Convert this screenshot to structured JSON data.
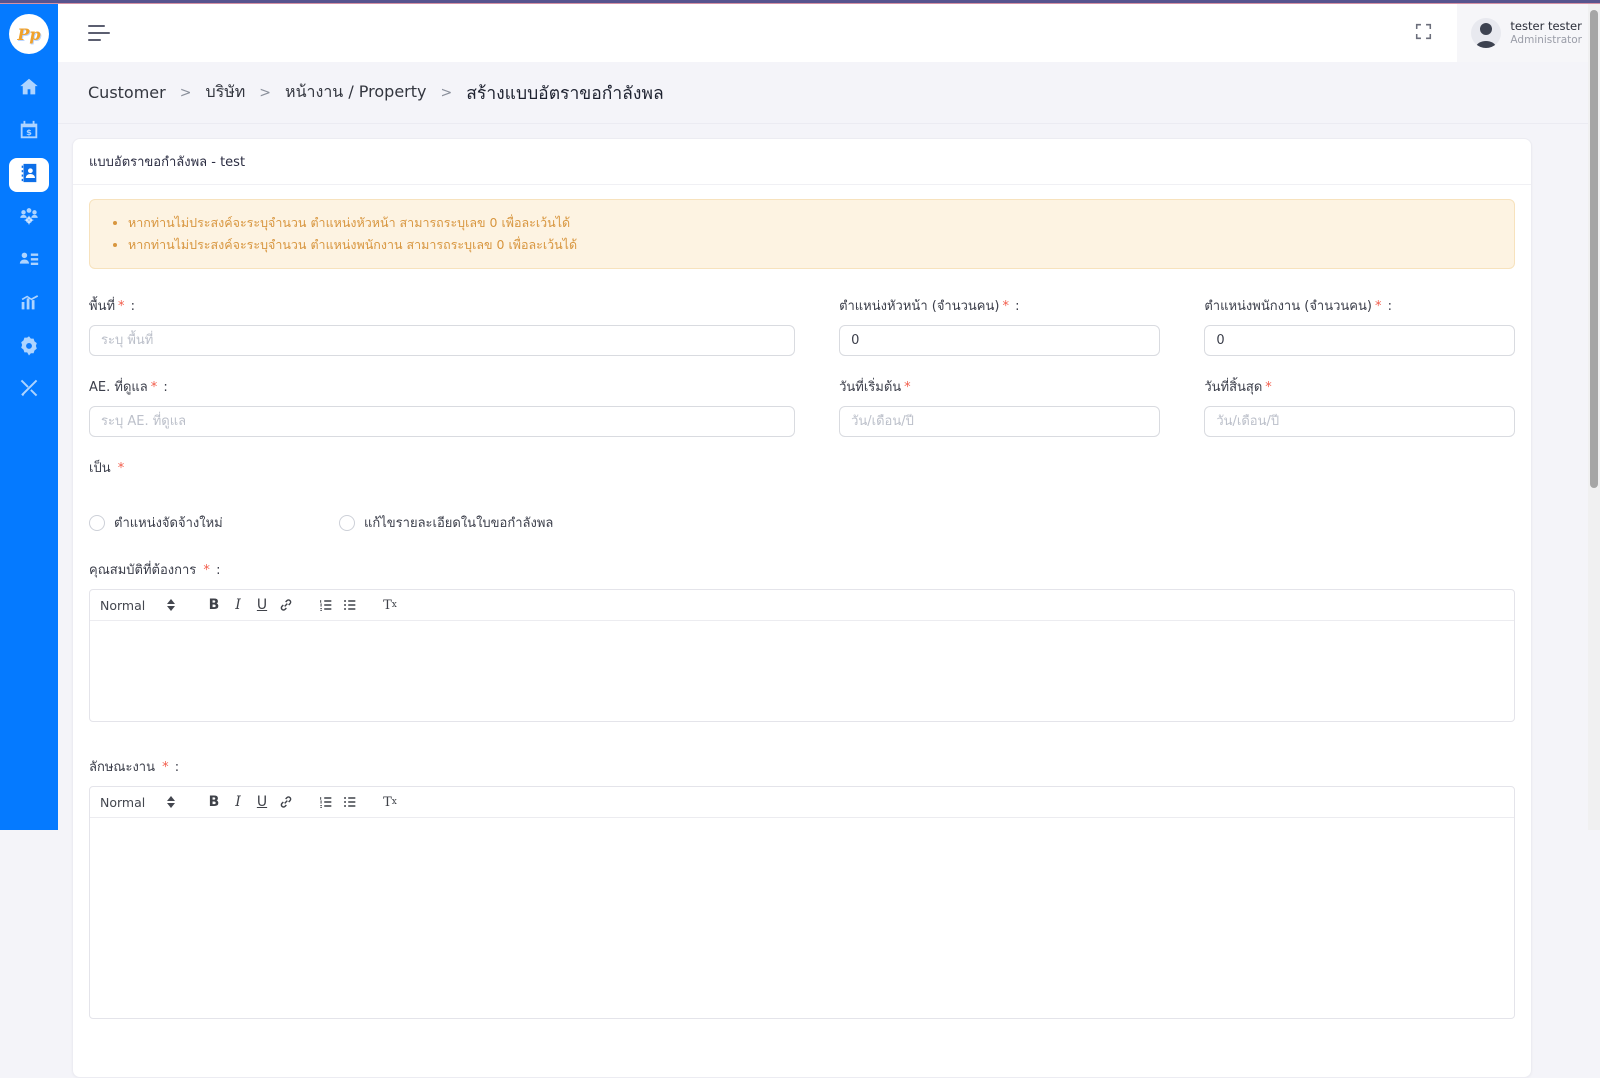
{
  "app": {
    "logo_text": "Pp"
  },
  "sidebar": {
    "color": "#057aff",
    "items": [
      {
        "name": "home",
        "active": false
      },
      {
        "name": "finance-calendar",
        "active": false
      },
      {
        "name": "customer-contacts",
        "active": true
      },
      {
        "name": "team-management",
        "active": false
      },
      {
        "name": "personnel-list",
        "active": false
      },
      {
        "name": "reports-chart",
        "active": false
      },
      {
        "name": "settings",
        "active": false
      },
      {
        "name": "tools",
        "active": false
      }
    ]
  },
  "user": {
    "name": "tester tester",
    "role": "Administrator"
  },
  "breadcrumb": {
    "separator": ">",
    "items": [
      "Customer",
      "บริษัท",
      "หน้างาน / Property",
      "สร้างแบบอัตราขอกำลังพล"
    ]
  },
  "card": {
    "title": "แบบอัตราขอกำลังพล - test"
  },
  "alert": {
    "text_color": "#d8963f",
    "background": "#fdf3e2",
    "items": [
      "หากท่านไม่ประสงค์จะระบุจำนวน ตำแหน่งหัวหน้า สามารถระบุเลข 0 เพื่อละเว้นได้",
      "หากท่านไม่ประสงค์จะระบุจำนวน ตำแหน่งพนักงาน สามารถระบุเลข 0 เพื่อละเว้นได้"
    ]
  },
  "form": {
    "required_mark": "*",
    "colon": ":",
    "area": {
      "label": "พื้นที่",
      "placeholder": "ระบุ พื้นที่",
      "value": ""
    },
    "head_count": {
      "label": "ตำแหน่งหัวหน้า (จำนวนคน)",
      "value": "0"
    },
    "staff_count": {
      "label": "ตำแหน่งพนักงาน (จำนวนคน)",
      "value": "0"
    },
    "ae": {
      "label": "AE. ที่ดูแล",
      "placeholder": "ระบุ AE. ที่ดูแล",
      "value": ""
    },
    "start_date": {
      "label": "วันที่เริ่มต้น",
      "placeholder": "วัน/เดือน/ปี",
      "value": ""
    },
    "end_date": {
      "label": "วันที่สิ้นสุด",
      "placeholder": "วัน/เดือน/ปี",
      "value": ""
    },
    "type": {
      "label": "เป็น",
      "options": [
        "ตำแหน่งจัดจ้างใหม่",
        "แก้ไขรายละเอียดในใบขอกำลังพล"
      ],
      "selected": ""
    },
    "qualification": {
      "label": "คุณสมบัติที่ต้องการ",
      "value": ""
    },
    "job_description": {
      "label": "ลักษณะงาน",
      "value": ""
    }
  },
  "editor_toolbar": {
    "format": "Normal",
    "bold": "B",
    "italic": "I",
    "underline": "U",
    "clean_t": "T",
    "clean_x": "x"
  }
}
